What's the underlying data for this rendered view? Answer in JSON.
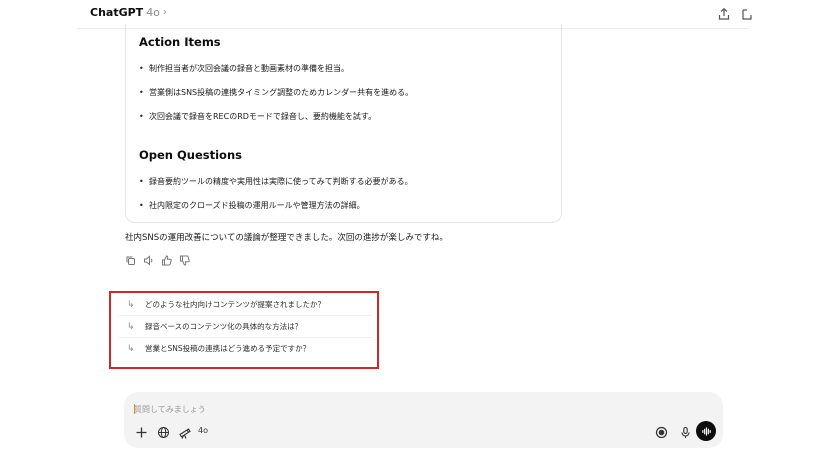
{
  "header": {
    "model_name": "ChatGPT",
    "model_version": "4o"
  },
  "response": {
    "sections": [
      {
        "title": "Action Items",
        "items": [
          "制作担当者が次回会議の録音と動画素材の準備を担当。",
          "営業側はSNS投稿の連携タイミング調整のためカレンダー共有を進める。",
          "次回会議で録音をRECのRDモードで録音し、要約機能を試す。"
        ]
      },
      {
        "title": "Open Questions",
        "items": [
          "録音要約ツールの精度や実用性は実際に使ってみて判断する必要がある。",
          "社内限定のクローズド投稿の運用ルールや管理方法の詳細。"
        ]
      }
    ],
    "summary": "社内SNSの運用改善についての議論が整理できました。次回の進捗が楽しみですね。"
  },
  "suggestions": [
    "どのような社内向けコンテンツが提案されましたか？",
    "録音ベースのコンテンツ化の具体的な方法は？",
    "営業とSNS投稿の連携はどう進める予定ですか？"
  ],
  "composer": {
    "placeholder": "質問してみましょう",
    "model_tag": "4o"
  },
  "colors": {
    "highlight_border": "#cc2a2a",
    "composer_bg": "#f3f3f3",
    "voice_button": "#0d0d0d"
  }
}
